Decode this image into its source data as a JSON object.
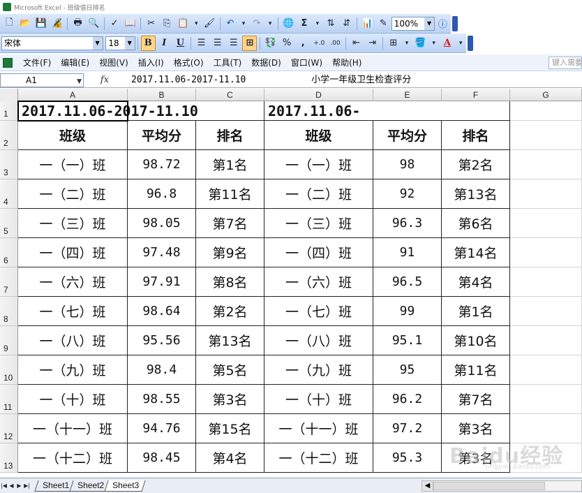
{
  "window": {
    "title": "Microsoft Excel - 班级值日排名"
  },
  "toolbar": {
    "zoom": "100%",
    "font_name": "宋体",
    "font_size": "18",
    "bold_label": "B",
    "italic_label": "I",
    "underline_label": "U",
    "percent_label": "%",
    "comma_label": ",",
    "sigma_label": "Σ",
    "font_color_label": "A"
  },
  "menu": {
    "items": [
      "文件(F)",
      "编辑(E)",
      "视图(V)",
      "插入(I)",
      "格式(O)",
      "工具(T)",
      "数据(D)",
      "窗口(W)",
      "帮助(H)"
    ],
    "help_search_placeholder": "键入需要"
  },
  "formula_bar": {
    "name_box": "A1",
    "fx": "fx",
    "content": "2017.11.06-2017-11.10            小学一年级卫生检查评分"
  },
  "grid": {
    "columns": [
      "A",
      "B",
      "C",
      "D",
      "E",
      "F",
      "G"
    ],
    "rows": [
      "1",
      "2",
      "3",
      "4",
      "5",
      "6",
      "7",
      "8",
      "9",
      "10",
      "11",
      "12",
      "13"
    ],
    "title_left": "2017.11.06-2017-11.10",
    "title_right": "2017.11.06-",
    "headers": [
      "班级",
      "平均分",
      "排名",
      "班级",
      "平均分",
      "排名"
    ],
    "data": [
      [
        "一（一）班",
        "98.72",
        "第1名",
        "一（一）班",
        "98",
        "第2名"
      ],
      [
        "一（二）班",
        "96.8",
        "第11名",
        "一（二）班",
        "92",
        "第13名"
      ],
      [
        "一（三）班",
        "98.05",
        "第7名",
        "一（三）班",
        "96.3",
        "第6名"
      ],
      [
        "一（四）班",
        "97.48",
        "第9名",
        "一（四）班",
        "91",
        "第14名"
      ],
      [
        "一（六）班",
        "97.91",
        "第8名",
        "一（六）班",
        "96.5",
        "第4名"
      ],
      [
        "一（七）班",
        "98.64",
        "第2名",
        "一（七）班",
        "99",
        "第1名"
      ],
      [
        "一（八）班",
        "95.56",
        "第13名",
        "一（八）班",
        "95.1",
        "第10名"
      ],
      [
        "一（九）班",
        "98.4",
        "第5名",
        "一（九）班",
        "95",
        "第11名"
      ],
      [
        "一（十）班",
        "98.55",
        "第3名",
        "一（十）班",
        "96.2",
        "第7名"
      ],
      [
        "一（十一）班",
        "94.76",
        "第15名",
        "一（十一）班",
        "97.2",
        "第3名"
      ],
      [
        "一（十二）班",
        "98.45",
        "第4名",
        "一（十二）班",
        "95.3",
        "第3名"
      ]
    ]
  },
  "sheets": {
    "tabs": [
      "Sheet1",
      "Sheet2",
      "Sheet3"
    ],
    "active": "Sheet3"
  },
  "watermark": {
    "text": "Baidu经验",
    "sub": "jingyan.baidu.com"
  }
}
